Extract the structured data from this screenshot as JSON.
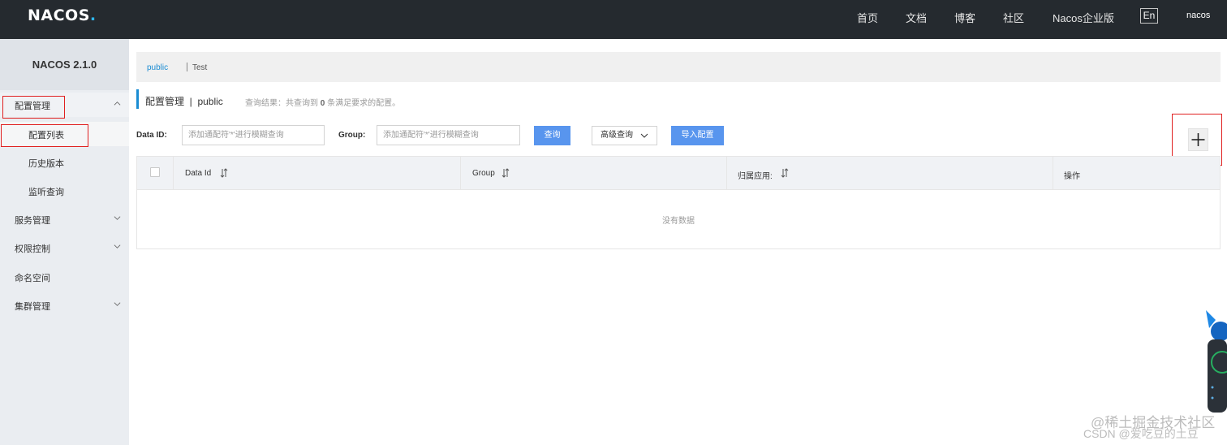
{
  "header": {
    "logo": "NACOS.",
    "nav": [
      "首页",
      "文档",
      "博客",
      "社区",
      "Nacos企业版"
    ],
    "lang": "En",
    "user": "nacos"
  },
  "sidebar": {
    "version": "NACOS 2.1.0",
    "items": [
      {
        "label": "配置管理",
        "expanded": true
      },
      {
        "label": "配置列表"
      },
      {
        "label": "历史版本"
      },
      {
        "label": "监听查询"
      },
      {
        "label": "服务管理"
      },
      {
        "label": "权限控制"
      },
      {
        "label": "命名空间"
      },
      {
        "label": "集群管理"
      }
    ]
  },
  "namespaces": {
    "active": "public",
    "other": "Test"
  },
  "page": {
    "title": "配置管理  |  public",
    "summary_prefix": "查询结果：共查询到",
    "summary_count": "0",
    "summary_suffix": "条满足要求的配置。"
  },
  "search": {
    "dataid_label": "Data ID:",
    "dataid_placeholder": "添加通配符'*'进行模糊查询",
    "group_label": "Group:",
    "group_placeholder": "添加通配符'*'进行模糊查询",
    "query_button": "查询",
    "advanced_button": "高级查询",
    "import_button": "导入配置"
  },
  "table": {
    "columns": [
      "Data Id",
      "Group",
      "归属应用:",
      "操作"
    ],
    "empty_text": "没有数据"
  },
  "watermark": {
    "line1": "@稀土掘金技术社区",
    "line2": "CSDN @爱吃豆的土豆"
  },
  "colors": {
    "header_bg": "#252a2f",
    "sidebar_bg": "#eaedf1",
    "primary_button": "#5895ee",
    "accent": "#1a8cd3",
    "highlight_box": "#e02020"
  }
}
